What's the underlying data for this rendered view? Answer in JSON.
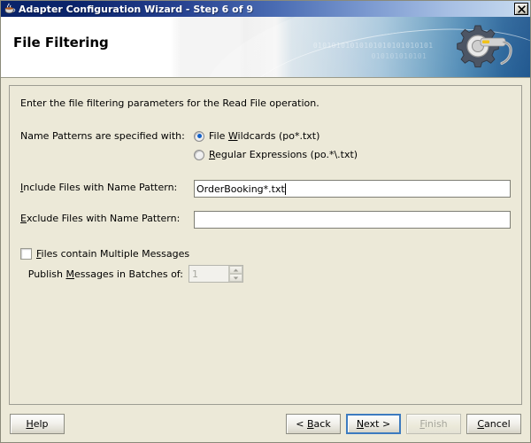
{
  "window": {
    "title": "Adapter Configuration Wizard - Step 6 of 9",
    "icon": "java-coffee-cup-icon",
    "close_label": "✕"
  },
  "banner": {
    "heading": "File Filtering",
    "binary_text_1": "01010101010101010101010101",
    "binary_text_2": "010101010101",
    "gear_icon": "gear-wrench-icon"
  },
  "content": {
    "intro": "Enter the file filtering parameters for the Read File operation.",
    "name_patterns": {
      "label": "Name Patterns are specified with:",
      "options": [
        {
          "label_pre": "File ",
          "mnemonic": "W",
          "label_post": "ildcards (po*.txt)",
          "selected": true
        },
        {
          "label_pre": "",
          "mnemonic": "R",
          "label_post": "egular Expressions (po.*\\.txt)",
          "selected": false
        }
      ]
    },
    "include": {
      "label_pre": "",
      "mnemonic": "I",
      "label_post": "nclude Files with Name Pattern:",
      "value": "OrderBooking*.txt",
      "placeholder": ""
    },
    "exclude": {
      "label_pre": "",
      "mnemonic": "E",
      "label_post": "xclude Files with Name Pattern:",
      "value": "",
      "placeholder": ""
    },
    "multiple_messages": {
      "label_pre": "",
      "mnemonic": "F",
      "label_post": "iles contain Multiple Messages",
      "checked": false
    },
    "batch": {
      "label_pre": "Publish ",
      "mnemonic": "M",
      "label_post": "essages in Batches of:",
      "value": "1",
      "enabled": false
    }
  },
  "buttons": {
    "help": "Help",
    "back": "< Back",
    "back_mnemonic": "B",
    "next": "Next >",
    "next_mnemonic": "N",
    "finish": "Finish",
    "finish_mnemonic": "F",
    "cancel": "Cancel",
    "cancel_mnemonic": "C"
  },
  "colors": {
    "titlebar_start": "#0a246a",
    "titlebar_end": "#c8dcf0",
    "dialog_bg": "#ece9d8",
    "radio_dot": "#1060c8",
    "default_button_border": "#3d7bbf",
    "disabled_text": "#a6a69c"
  }
}
